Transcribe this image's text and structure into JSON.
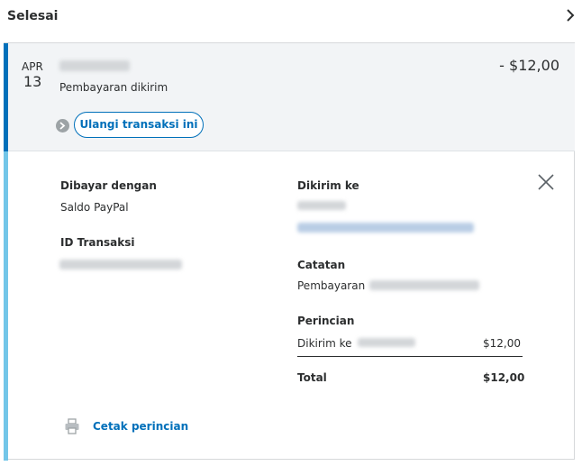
{
  "header": {
    "title": "Selesai",
    "chevron_icon": "chevron-right-icon"
  },
  "transaction": {
    "month": "APR",
    "day": "13",
    "status": "Pembayaran dikirim",
    "amount": "- $12,00",
    "repeat_label": "Ulangi transaksi ini"
  },
  "details": {
    "paid_with_label": "Dibayar dengan",
    "paid_with_value": "Saldo PayPal",
    "transaction_id_label": "ID Transaksi",
    "sent_to_label": "Dikirim ke",
    "note_label": "Catatan",
    "note_prefix": "Pembayaran",
    "breakdown_label": "Perincian",
    "breakdown_row_label": "Dikirim ke",
    "breakdown_row_amount": "$12,00",
    "total_label": "Total",
    "total_amount": "$12,00",
    "print_label": "Cetak perincian"
  },
  "colors": {
    "accent": "#0070ba",
    "light_accent": "#73c6e8",
    "summary_bg": "#f2f4f6"
  }
}
